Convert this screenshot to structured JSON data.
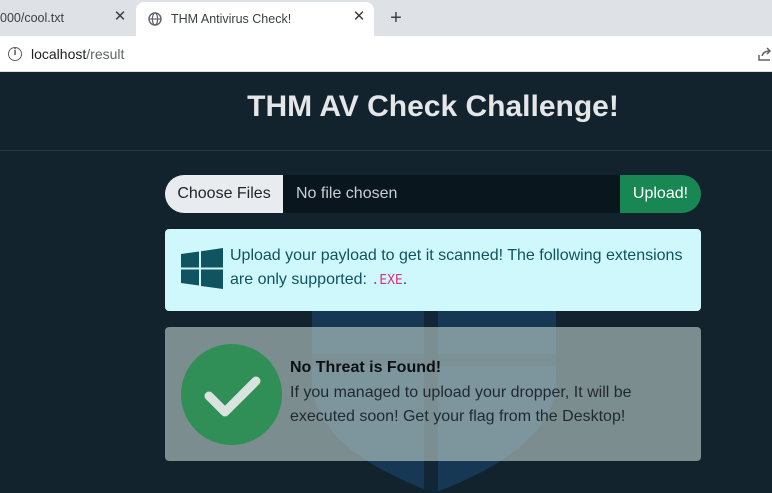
{
  "browser": {
    "tabs": [
      {
        "title": "000/cool.txt",
        "active": false
      },
      {
        "title": "THM Antivirus Check!",
        "active": true
      }
    ],
    "close_glyph": "✕",
    "new_tab_glyph": "+",
    "address": {
      "host": "localhost",
      "path": "/result"
    },
    "icons": [
      "globe-icon",
      "info-icon",
      "share-icon",
      "close-icon",
      "plus-icon"
    ]
  },
  "page": {
    "title": "THM AV Check Challenge!",
    "upload": {
      "choose_label": "Choose Files",
      "file_status": "No file chosen",
      "submit_label": "Upload!"
    },
    "info_alert": {
      "text": "Upload your payload to get it scanned! The following extensions are only supported: ",
      "extension": ".EXE",
      "suffix": ".",
      "icon": "windows-logo-icon"
    },
    "result": {
      "title": "No Threat is Found!",
      "body": "If you managed to upload your dropper, It will be executed soon! Get your flag from the Desktop!",
      "icon": "checkmark-icon"
    }
  },
  "colors": {
    "page_background": "#12232e",
    "upload_button": "#198754",
    "info_background": "#cff8fc",
    "info_text": "#0f5460",
    "check_circle": "#2f8f57",
    "code": "#d63384"
  }
}
